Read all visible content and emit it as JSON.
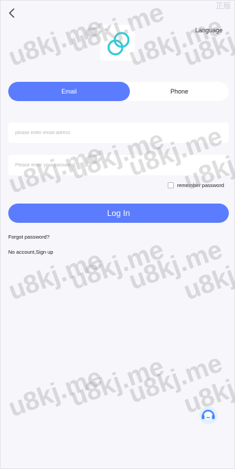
{
  "header": {
    "language_label": "Language",
    "corner_text": "正版"
  },
  "tabs": [
    {
      "label": "Email"
    },
    {
      "label": "Phone"
    }
  ],
  "form": {
    "email_placeholder": "please enter email adress",
    "password_placeholder": "Please enter your password",
    "remember_label": "remember password",
    "login_label": "Log In"
  },
  "links": {
    "forgot_password": "Forgot password?",
    "no_account": "No account,",
    "sign_up": "Sign up"
  },
  "watermark": "u8kj.me",
  "colors": {
    "accent": "#5b7cff",
    "logo": "#35c9d8",
    "support": "#3a86ff"
  },
  "icons": {
    "back": "back-chevron-icon",
    "logo": "infinity-logo",
    "support": "customer-service-icon"
  }
}
